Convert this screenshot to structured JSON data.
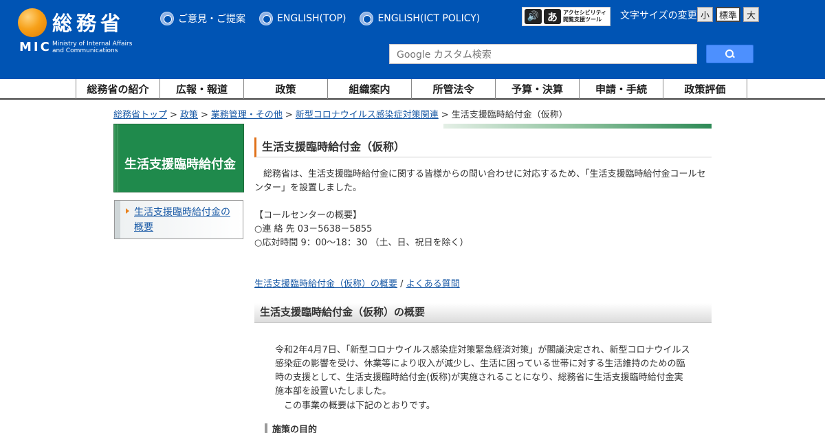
{
  "header": {
    "logo": {
      "kanji": "総務省",
      "abbr": "MIC",
      "english_line1": "Ministry of Internal Affairs",
      "english_line2": "and Communications"
    },
    "top_links": [
      {
        "label": "ご意見・ご提案"
      },
      {
        "label": "ENGLISH(TOP)"
      },
      {
        "label": "ENGLISH(ICT POLICY)"
      }
    ],
    "accessibility": {
      "icon_a": "あ",
      "label_line1": "アクセシビリティ",
      "label_line2": "閲覧支援ツール"
    },
    "font_size": {
      "label": "文字サイズの変更",
      "small": "小",
      "normal": "標準",
      "large": "大",
      "selected": "標準"
    },
    "search": {
      "placeholder": "Google カスタム検索",
      "icon": "search-icon"
    },
    "colors": {
      "header_bg": "#0054b4",
      "accent": "#f7a11a"
    }
  },
  "global_nav": [
    {
      "label": "総務省の紹介"
    },
    {
      "label": "広報・報道"
    },
    {
      "label": "政策"
    },
    {
      "label": "組織案内"
    },
    {
      "label": "所管法令"
    },
    {
      "label": "予算・決算"
    },
    {
      "label": "申請・手続"
    },
    {
      "label": "政策評価"
    }
  ],
  "breadcrumb": {
    "links": [
      "総務省トップ",
      "政策",
      "業務管理・その他",
      "新型コロナウイルス感染症対策関連"
    ],
    "separator": ">",
    "current": "生活支援臨時給付金（仮称）"
  },
  "sidebar": {
    "title": "生活支援臨時給付金",
    "menu": [
      {
        "label": "生活支援臨時給付金の概要"
      }
    ]
  },
  "main": {
    "title": "生活支援臨時給付金（仮称）",
    "intro": "総務省は、生活支援臨時給付金に関する皆様からの問い合わせに対応するため、「生活支援臨時給付金コールセンター」を設置しました。",
    "call_center": {
      "title": "【コールセンターの概要】",
      "tel": "○連 絡 先 03－5638－5855",
      "hours": "○応対時間 9：00～18：30 （土、日、祝日を除く）"
    },
    "links": {
      "overview": "生活支援臨時給付金（仮称）の概要",
      "separator": "/",
      "faq": "よくある質問"
    },
    "section_title": "生活支援臨時給付金（仮称）の概要",
    "section_body": "令和2年4月7日、「新型コロナウイルス感染症対策緊急経済対策」が閣議決定され、新型コロナウイルス感染症の影響を受け、休業等により収入が減少し、生活に困っている世帯に対する生活維持のための臨時の支援として、生活支援臨時給付金(仮称)が実施されることになり、総務省に生活支援臨時給付金実施本部を設置いたしました。",
    "section_body_2": "この事業の概要は下記のとおりです。",
    "sub_heading": "施策の目的"
  }
}
